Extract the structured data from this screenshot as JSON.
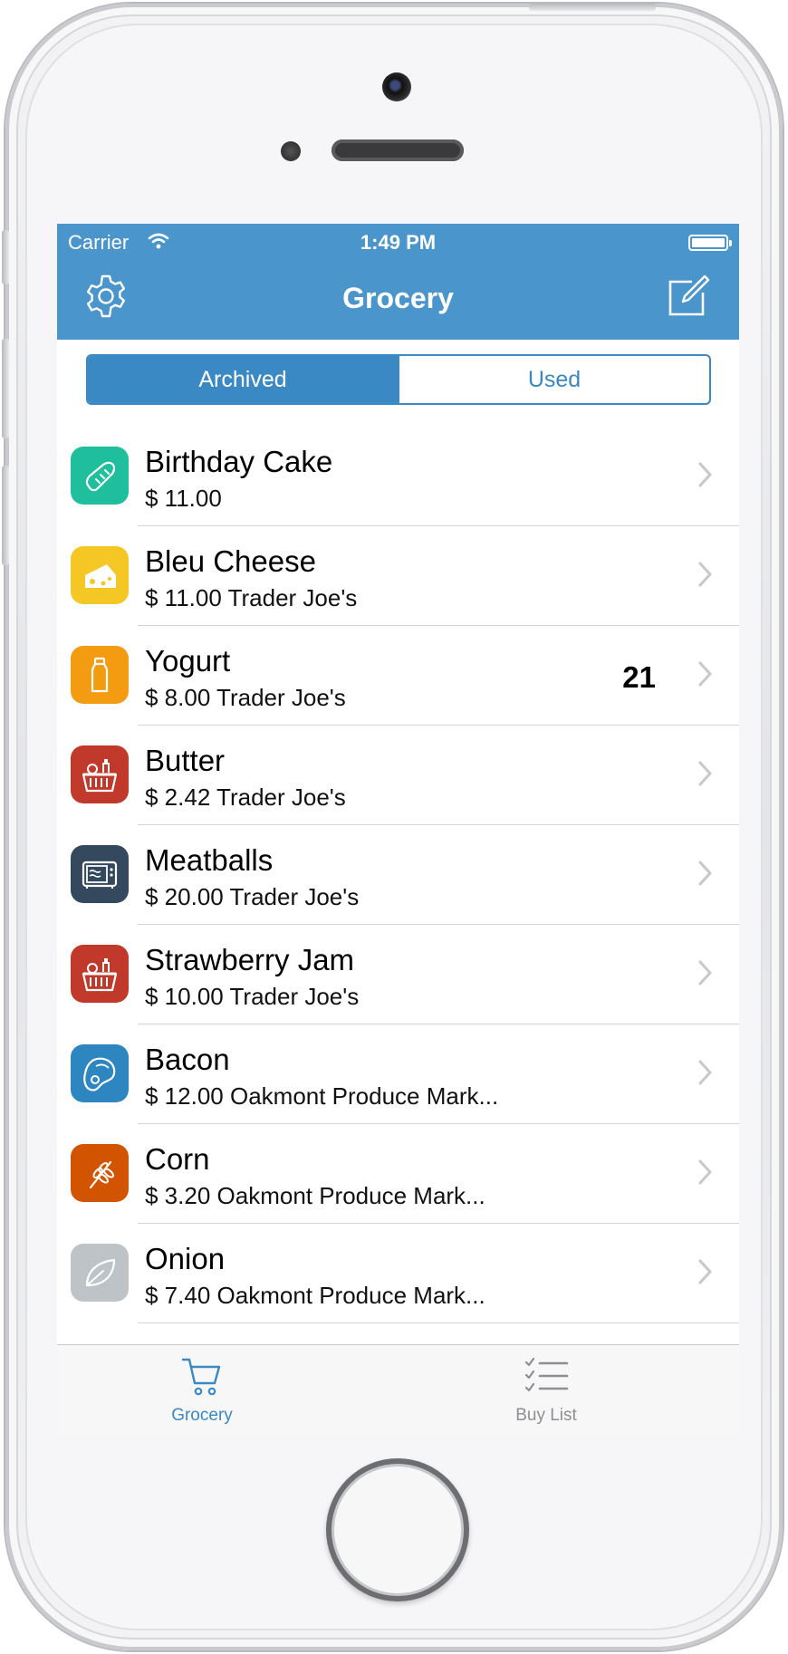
{
  "status_bar": {
    "carrier": "Carrier",
    "time": "1:49 PM"
  },
  "nav": {
    "title": "Grocery",
    "left_icon": "gear-icon",
    "right_icon": "compose-icon"
  },
  "segments": {
    "archived": "Archived",
    "used": "Used",
    "selected": "Archived"
  },
  "items": [
    {
      "name": "Birthday Cake",
      "detail": "$ 11.00",
      "count": "",
      "icon": "bread-icon",
      "color": "#1fbf9d"
    },
    {
      "name": "Bleu Cheese",
      "detail": "$ 11.00 Trader Joe's",
      "count": "",
      "icon": "cheese-icon",
      "color": "#f4c724"
    },
    {
      "name": "Yogurt",
      "detail": "$ 8.00 Trader Joe's",
      "count": "21",
      "icon": "bottle-icon",
      "color": "#f39c12"
    },
    {
      "name": "Butter",
      "detail": "$ 2.42 Trader Joe's",
      "count": "",
      "icon": "basket-icon",
      "color": "#c0392b"
    },
    {
      "name": "Meatballs",
      "detail": "$ 20.00 Trader Joe's",
      "count": "",
      "icon": "microwave-icon",
      "color": "#34495e"
    },
    {
      "name": "Strawberry Jam",
      "detail": "$ 10.00 Trader Joe's",
      "count": "",
      "icon": "basket-icon",
      "color": "#c0392b"
    },
    {
      "name": "Bacon",
      "detail": "$ 12.00 Oakmont Produce Mark...",
      "count": "",
      "icon": "steak-icon",
      "color": "#2e86c1"
    },
    {
      "name": "Corn",
      "detail": "$ 3.20 Oakmont Produce Mark...",
      "count": "",
      "icon": "wheat-icon",
      "color": "#d35400"
    },
    {
      "name": "Onion",
      "detail": "$ 7.40 Oakmont Produce Mark...",
      "count": "",
      "icon": "leaf-icon",
      "color": "#bdc3c7"
    }
  ],
  "tabs": [
    {
      "label": "Grocery",
      "icon": "cart-icon",
      "active": true
    },
    {
      "label": "Buy List",
      "icon": "checklist-icon",
      "active": false
    }
  ],
  "colors": {
    "accent": "#3a88c4",
    "navbar": "#4a95cc"
  }
}
